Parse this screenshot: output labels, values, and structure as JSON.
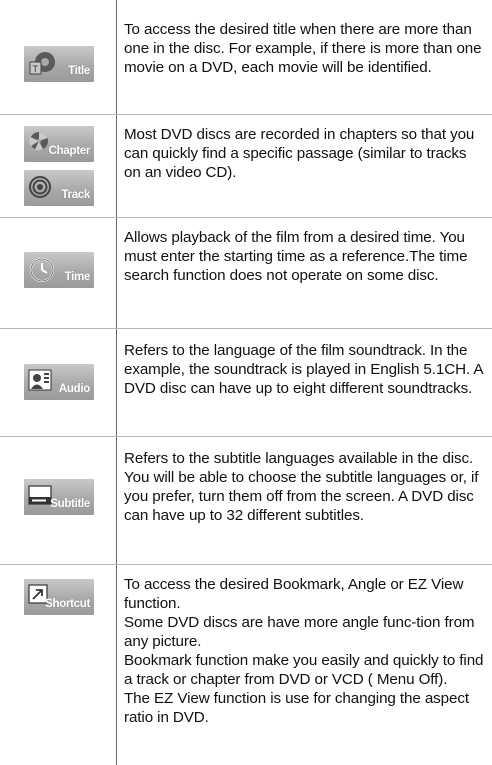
{
  "rows": [
    {
      "icon_label": "Title",
      "icon": "title-icon",
      "text": "To access the desired title when there are more than one in the disc. For example, if there is more than one movie on a DVD, each movie will be identified."
    },
    {
      "icon_label": "Chapter",
      "icon": "chapter-icon",
      "icon2_label": "Track",
      "icon2": "track-icon",
      "text": "Most DVD discs are recorded in chapters so that you can quickly find a specific passage (similar to tracks on an video CD)."
    },
    {
      "icon_label": "Time",
      "icon": "time-icon",
      "text": "Allows playback of the film from a desired time. You must enter the starting time as a reference.The time search function does not operate on some disc."
    },
    {
      "icon_label": "Audio",
      "icon": "audio-icon",
      "text": "Refers to the language of the film soundtrack. In the example, the soundtrack is played in English 5.1CH. A DVD disc can have up to eight different soundtracks."
    },
    {
      "icon_label": "Subtitle",
      "icon": "subtitle-icon",
      "text": "Refers to the subtitle languages available in the disc. You will be able to choose the subtitle languages or, if you prefer, turn them off from the screen. A DVD disc can have up to 32 different subtitles."
    },
    {
      "icon_label": "Shortcut",
      "icon": "shortcut-icon",
      "text": "To access the desired Bookmark, Angle  or EZ View function.\nSome DVD discs are have more angle func-tion from any picture.\nBookmark function make you easily and quickly to find a track or chapter from DVD or VCD ( Menu Off).\nThe EZ View function is use for changing the aspect ratio in DVD."
    }
  ]
}
